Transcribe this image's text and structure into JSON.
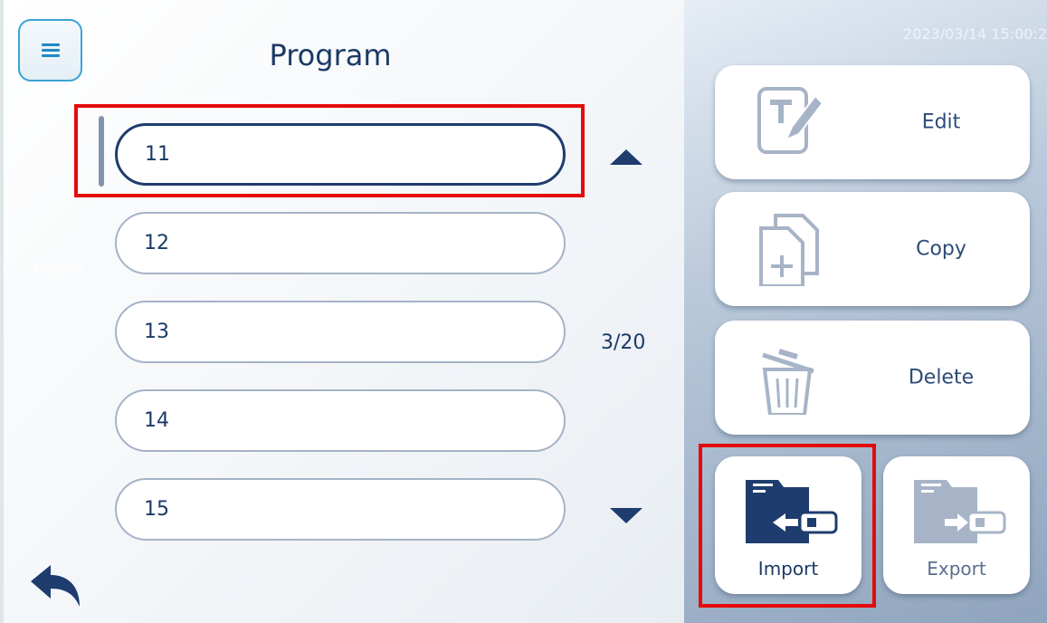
{
  "header": {
    "title": "Program",
    "datetime": "2023/03/14 15:00:2",
    "ghost_label": "Program"
  },
  "program_list": {
    "items": [
      {
        "label": "11",
        "selected": true
      },
      {
        "label": "12",
        "selected": false
      },
      {
        "label": "13",
        "selected": false
      },
      {
        "label": "14",
        "selected": false
      },
      {
        "label": "15",
        "selected": false
      }
    ],
    "page_indicator": "3/20"
  },
  "actions": {
    "edit_label": "Edit",
    "copy_label": "Copy",
    "delete_label": "Delete",
    "import_label": "Import",
    "export_label": "Export"
  },
  "icons": {
    "menu": "hamburger-icon",
    "up": "triangle-up-icon",
    "down": "triangle-down-icon",
    "back": "back-arrow-icon",
    "edit": "edit-document-icon",
    "copy": "copy-add-icon",
    "delete": "trash-icon",
    "import": "folder-usb-import-icon",
    "export": "folder-usb-export-icon"
  },
  "colors": {
    "primary": "#1f3c6e",
    "highlight": "#e40b0b",
    "menu_accent": "#3aa3d4",
    "muted_icon": "#a7b4c7"
  }
}
